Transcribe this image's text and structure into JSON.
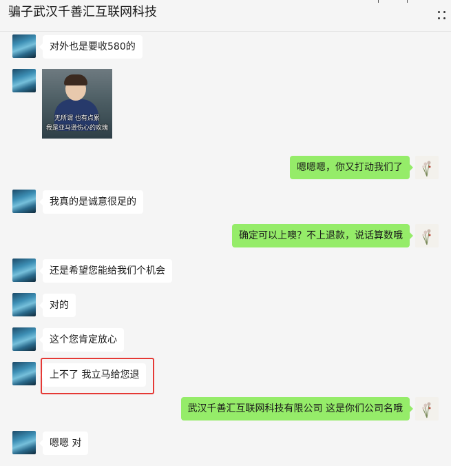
{
  "header": {
    "title": "骗子武汉千善汇互联网科技",
    "more_icon": "more-icon"
  },
  "messages": [
    {
      "side": "left",
      "type": "text",
      "text": "对外也是要收580的"
    },
    {
      "side": "left",
      "type": "sticker",
      "caption_line1": "无所谓   也有点累",
      "caption_line2": "我是亚马逊伤心的玫瑰"
    },
    {
      "side": "right",
      "type": "text",
      "text": "嗯嗯嗯，你又打动我们了"
    },
    {
      "side": "left",
      "type": "text",
      "text": "我真的是诚意很足的"
    },
    {
      "side": "right",
      "type": "text",
      "text": "确定可以上噢？不上退款，说话算数哦"
    },
    {
      "side": "left",
      "type": "text",
      "text": "还是希望您能给我们个机会"
    },
    {
      "side": "left",
      "type": "text",
      "text": "对的"
    },
    {
      "side": "left",
      "type": "text",
      "text": "这个您肯定放心"
    },
    {
      "side": "left",
      "type": "text",
      "text": "上不了 我立马给您退",
      "highlighted": true
    },
    {
      "side": "right",
      "type": "text",
      "text": "武汉千善汇互联网科技有限公司 这是你们公司名哦"
    },
    {
      "side": "left",
      "type": "text",
      "text": "嗯嗯 对"
    }
  ],
  "colors": {
    "background": "#f5f5f5",
    "bubble_left": "#ffffff",
    "bubble_right": "#95ec69",
    "highlight": "#e53935"
  }
}
